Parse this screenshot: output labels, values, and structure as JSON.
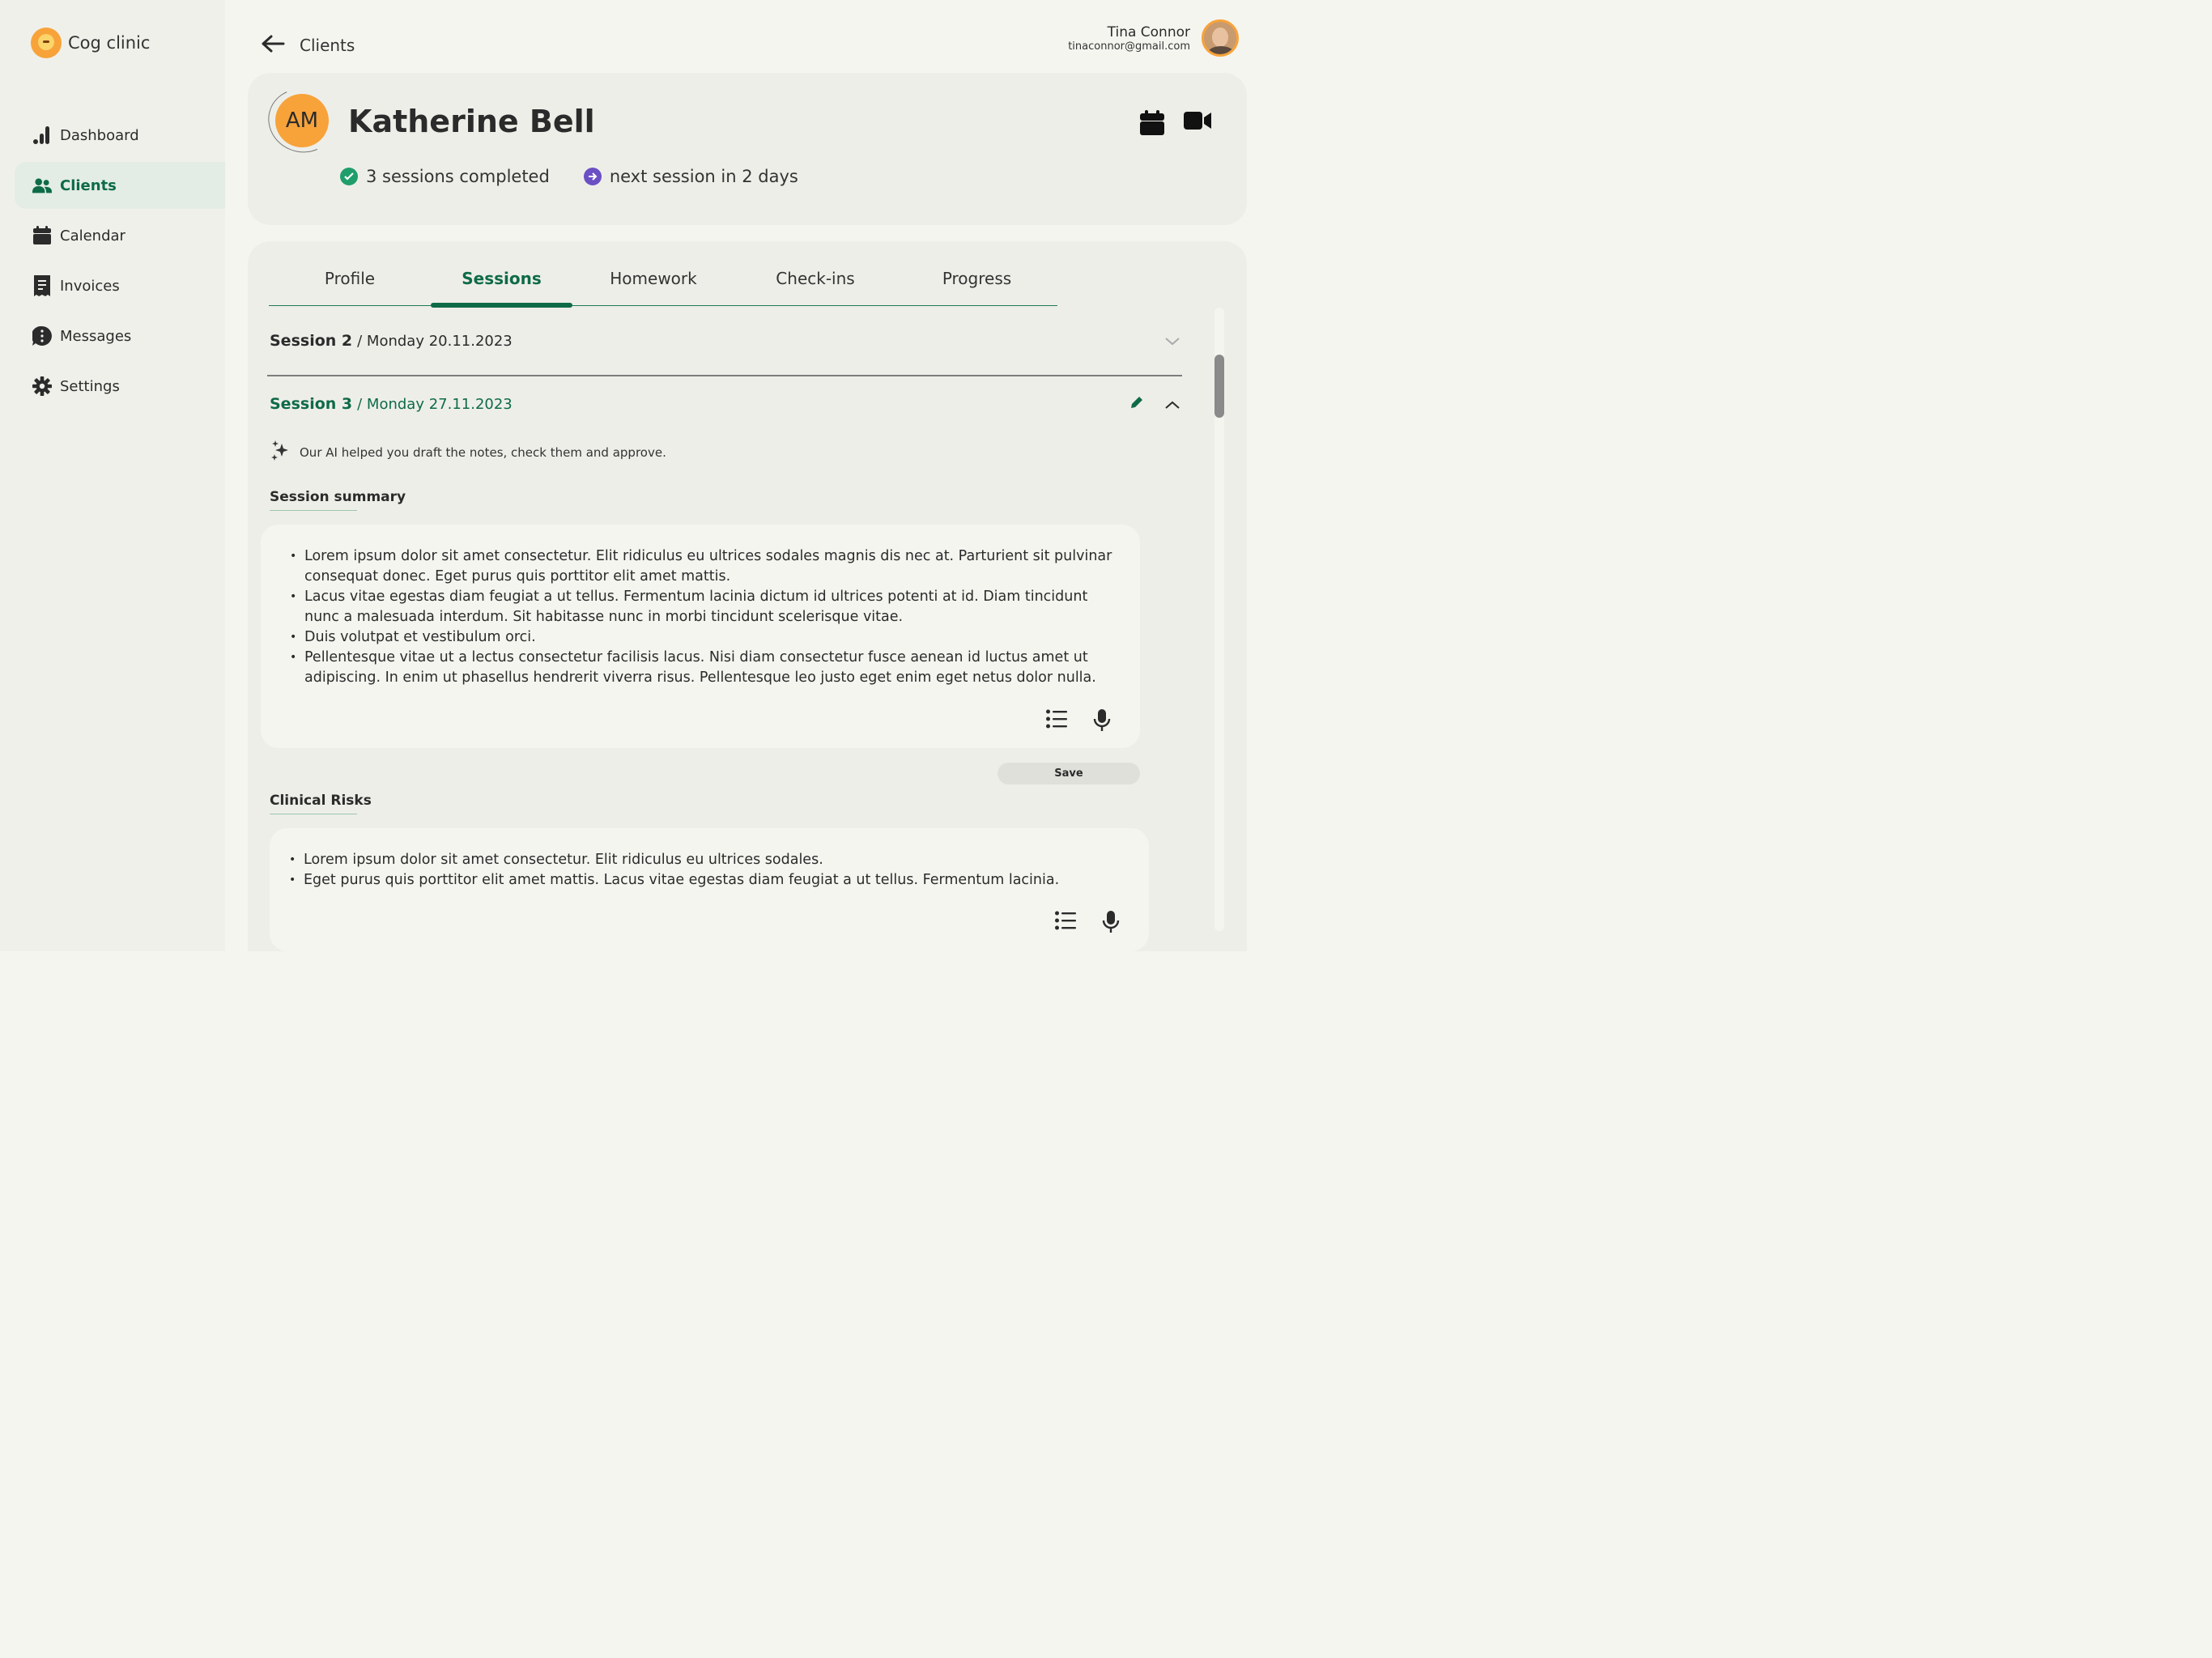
{
  "brand": {
    "name": "Cog clinic"
  },
  "nav": {
    "items": [
      {
        "label": "Dashboard",
        "icon": "bar-chart-icon"
      },
      {
        "label": "Clients",
        "icon": "users-icon"
      },
      {
        "label": "Calendar",
        "icon": "calendar-icon"
      },
      {
        "label": "Invoices",
        "icon": "receipt-icon"
      },
      {
        "label": "Messages",
        "icon": "chat-icon"
      },
      {
        "label": "Settings",
        "icon": "gear-icon"
      }
    ],
    "active": "Clients"
  },
  "header": {
    "back_label": "Clients"
  },
  "user": {
    "name": "Tina Connor",
    "email": "tinaconnor@gmail.com"
  },
  "client": {
    "initials": "AM",
    "name": "Katherine Bell",
    "sessions_completed": "3 sessions completed",
    "next_session": "next session in 2 days"
  },
  "tabs": [
    "Profile",
    "Sessions",
    "Homework",
    "Check-ins",
    "Progress"
  ],
  "active_tab": "Sessions",
  "sessions": [
    {
      "title": "Session 2",
      "date": "/ Monday 20.11.2023",
      "expanded": false
    },
    {
      "title": "Session 3",
      "date": "/ Monday 27.11.2023",
      "expanded": true
    }
  ],
  "ai_note": "Our AI helped you draft the notes, check them and approve.",
  "session_summary": {
    "heading": "Session summary",
    "bullets": [
      "Lorem ipsum dolor sit amet consectetur. Elit ridiculus eu ultrices sodales magnis dis nec at. Parturient sit pulvinar consequat donec. Eget purus quis porttitor elit amet mattis.",
      "Lacus vitae egestas diam feugiat a ut tellus. Fermentum lacinia dictum id ultrices potenti at id. Diam tincidunt nunc a malesuada interdum. Sit habitasse nunc in morbi tincidunt scelerisque vitae.",
      "Duis volutpat et vestibulum orci.",
      "Pellentesque vitae ut a lectus consectetur facilisis lacus. Nisi diam consectetur fusce aenean id luctus amet ut adipiscing. In enim ut phasellus hendrerit viverra risus. Pellentesque leo justo eget enim eget netus dolor nulla."
    ]
  },
  "save_label": "Save",
  "clinical_risks": {
    "heading": "Clinical Risks",
    "bullets": [
      "Lorem ipsum dolor sit amet consectetur. Elit ridiculus eu ultrices sodales.",
      "Eget purus quis porttitor elit amet mattis. Lacus vitae egestas diam feugiat a ut tellus. Fermentum lacinia."
    ]
  },
  "colors": {
    "accent": "#0e6b47",
    "orange": "#f7a33a",
    "success": "#1f9e6b",
    "purple": "#6b4fc4",
    "background": "#f5f5f0",
    "card": "#eeeee9"
  }
}
